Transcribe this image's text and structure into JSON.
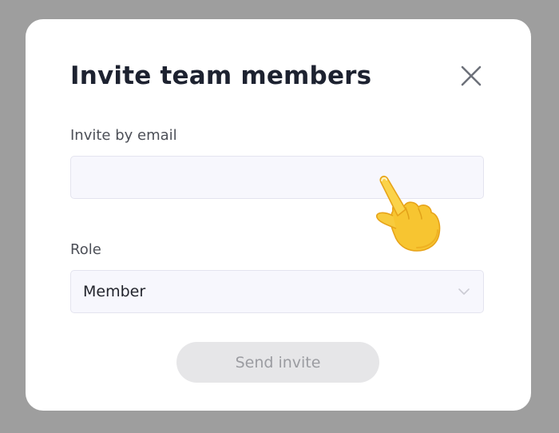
{
  "dialog": {
    "title": "Invite team members",
    "close_icon": "close-icon"
  },
  "email": {
    "label": "Invite by email",
    "value": "",
    "placeholder": ""
  },
  "role": {
    "label": "Role",
    "selected": "Member",
    "chevron_icon": "chevron-down-icon"
  },
  "actions": {
    "send_label": "Send invite",
    "send_enabled": false
  },
  "cursor": {
    "icon": "pointing-hand-cursor-icon"
  },
  "colors": {
    "backdrop": "#9e9e9e",
    "modal": "#ffffff",
    "title": "#1d2230",
    "field_bg": "#f7f7fd",
    "disabled_button_bg": "#e6e6e8",
    "disabled_button_text": "#9b9ca1",
    "cursor_yellow": "#f7c531"
  }
}
